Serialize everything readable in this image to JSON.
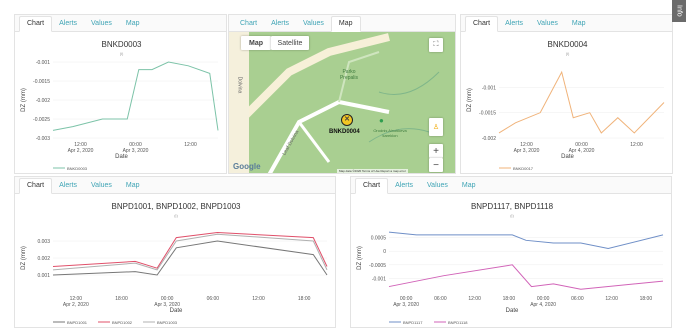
{
  "tabs_labels": [
    "Chart",
    "Alerts",
    "Values",
    "Map"
  ],
  "panel1": {
    "active": "Chart",
    "chart_data": {
      "type": "line",
      "title": "BNKD0003",
      "subtitle": "(i)",
      "ylabel": "DZ (mm)",
      "xlabel": "Date",
      "ylim": [
        -0.003,
        -0.001
      ],
      "yticks": [
        "-0.001",
        "-0.0015",
        "-0.002",
        "-0.0025",
        "-0.003"
      ],
      "xticks": [
        "12:00\nApr 2, 2020",
        "00:00\nApr 3, 2020",
        "12:00"
      ],
      "series": [
        {
          "name": "BNKD0003",
          "color": "#7cc3a8",
          "values": [
            [
              0,
              -0.0028
            ],
            [
              0.12,
              -0.0027
            ],
            [
              0.3,
              -0.0025
            ],
            [
              0.45,
              -0.0025
            ],
            [
              0.52,
              -0.0012
            ],
            [
              0.6,
              -0.0012
            ],
            [
              0.7,
              -0.001
            ],
            [
              0.82,
              -0.0011
            ],
            [
              0.95,
              -0.0013
            ],
            [
              1,
              -0.0028
            ]
          ]
        }
      ]
    }
  },
  "panel2": {
    "active": "Map",
    "map": {
      "map_label": "Map",
      "satellite_label": "Satellite",
      "marker_label": "BNKD0004",
      "park_label": "Parko Prepalis",
      "poi_label": "Orodnis Ainotikeva kareklon",
      "road1": "Leaf Dolvina",
      "road2": "Dolvina",
      "google": "Google",
      "attribution": "Map data ©2020   Terms of Use   Report a map error",
      "zoom_in": "+",
      "zoom_out": "−"
    }
  },
  "panel3": {
    "active": "Chart",
    "chart_data": {
      "type": "line",
      "title": "BNKD0004",
      "subtitle": "(i)",
      "ylabel": "DZ (mm)",
      "xlabel": "Date",
      "ylim": [
        -0.002,
        -0.0005
      ],
      "yticks": [
        "-0.001",
        "-0.0015",
        "-0.002"
      ],
      "xticks": [
        "12:00\nApr 3, 2020",
        "00:00\nApr 4, 2020",
        "12:00"
      ],
      "series": [
        {
          "name": "BNKD0017",
          "color": "#f0b37a",
          "values": [
            [
              0,
              -0.0019
            ],
            [
              0.1,
              -0.0017
            ],
            [
              0.25,
              -0.0015
            ],
            [
              0.38,
              -0.0007
            ],
            [
              0.45,
              -0.0016
            ],
            [
              0.55,
              -0.0015
            ],
            [
              0.62,
              -0.0019
            ],
            [
              0.72,
              -0.0016
            ],
            [
              0.82,
              -0.0019
            ],
            [
              1,
              -0.0013
            ]
          ]
        }
      ]
    }
  },
  "panel4": {
    "active": "Chart",
    "chart_data": {
      "type": "line",
      "title": "BNPD1001, BNPD1002, BNPD1003",
      "subtitle": "(i)",
      "ylabel": "DZ (mm)",
      "xlabel": "Date",
      "ylim": [
        0,
        0.004
      ],
      "yticks": [
        "0.003",
        "0.002",
        "0.001"
      ],
      "xticks": [
        "12:00\nApr 2, 2020",
        "18:00",
        "00:00\nApr 3, 2020",
        "06:00",
        "12:00",
        "18:00"
      ],
      "series": [
        {
          "name": "BNPD1001",
          "color": "#777777",
          "values": [
            [
              0,
              0.001
            ],
            [
              0.3,
              0.0012
            ],
            [
              0.38,
              0.001
            ],
            [
              0.45,
              0.0026
            ],
            [
              0.6,
              0.003
            ],
            [
              0.95,
              0.0022
            ],
            [
              1,
              0.001
            ]
          ]
        },
        {
          "name": "BNPD1002",
          "color": "#e0506a",
          "values": [
            [
              0,
              0.0015
            ],
            [
              0.3,
              0.0018
            ],
            [
              0.38,
              0.0014
            ],
            [
              0.45,
              0.0032
            ],
            [
              0.6,
              0.0035
            ],
            [
              0.95,
              0.0032
            ],
            [
              1,
              0.0015
            ]
          ]
        },
        {
          "name": "BNPD1003",
          "color": "#b0b0b0",
          "values": [
            [
              0,
              0.0013
            ],
            [
              0.3,
              0.0017
            ],
            [
              0.38,
              0.0013
            ],
            [
              0.45,
              0.003
            ],
            [
              0.6,
              0.0034
            ],
            [
              0.95,
              0.003
            ],
            [
              1,
              0.0013
            ]
          ]
        }
      ]
    }
  },
  "panel5": {
    "active": "Chart",
    "chart_data": {
      "type": "line",
      "title": "BNPD1117, BNPD1118",
      "subtitle": "(i)",
      "ylabel": "DZ (mm)",
      "xlabel": "Date",
      "ylim": [
        -0.0015,
        0.001
      ],
      "yticks": [
        "0.0005",
        "0",
        "-0.0005",
        "-0.001"
      ],
      "xticks": [
        "00:00\nApr 3, 2020",
        "06:00",
        "12:00",
        "18:00",
        "00:00\nApr 4, 2020",
        "06:00",
        "12:00",
        "18:00"
      ],
      "series": [
        {
          "name": "BNPD1117",
          "color": "#6f8fc7",
          "values": [
            [
              0,
              0.0007
            ],
            [
              0.1,
              0.0006
            ],
            [
              0.45,
              0.0006
            ],
            [
              0.5,
              0.0004
            ],
            [
              0.6,
              0.0003
            ],
            [
              0.7,
              0.0003
            ],
            [
              0.8,
              0.0001
            ],
            [
              1,
              0.0006
            ]
          ]
        },
        {
          "name": "BNPD1118",
          "color": "#d163b8",
          "values": [
            [
              0,
              -0.0013
            ],
            [
              0.2,
              -0.0009
            ],
            [
              0.45,
              -0.0005
            ],
            [
              0.52,
              -0.0013
            ],
            [
              0.6,
              -0.0012
            ],
            [
              0.7,
              -0.0014
            ],
            [
              1,
              -0.0011
            ]
          ]
        }
      ]
    }
  },
  "side_badge": "Info"
}
